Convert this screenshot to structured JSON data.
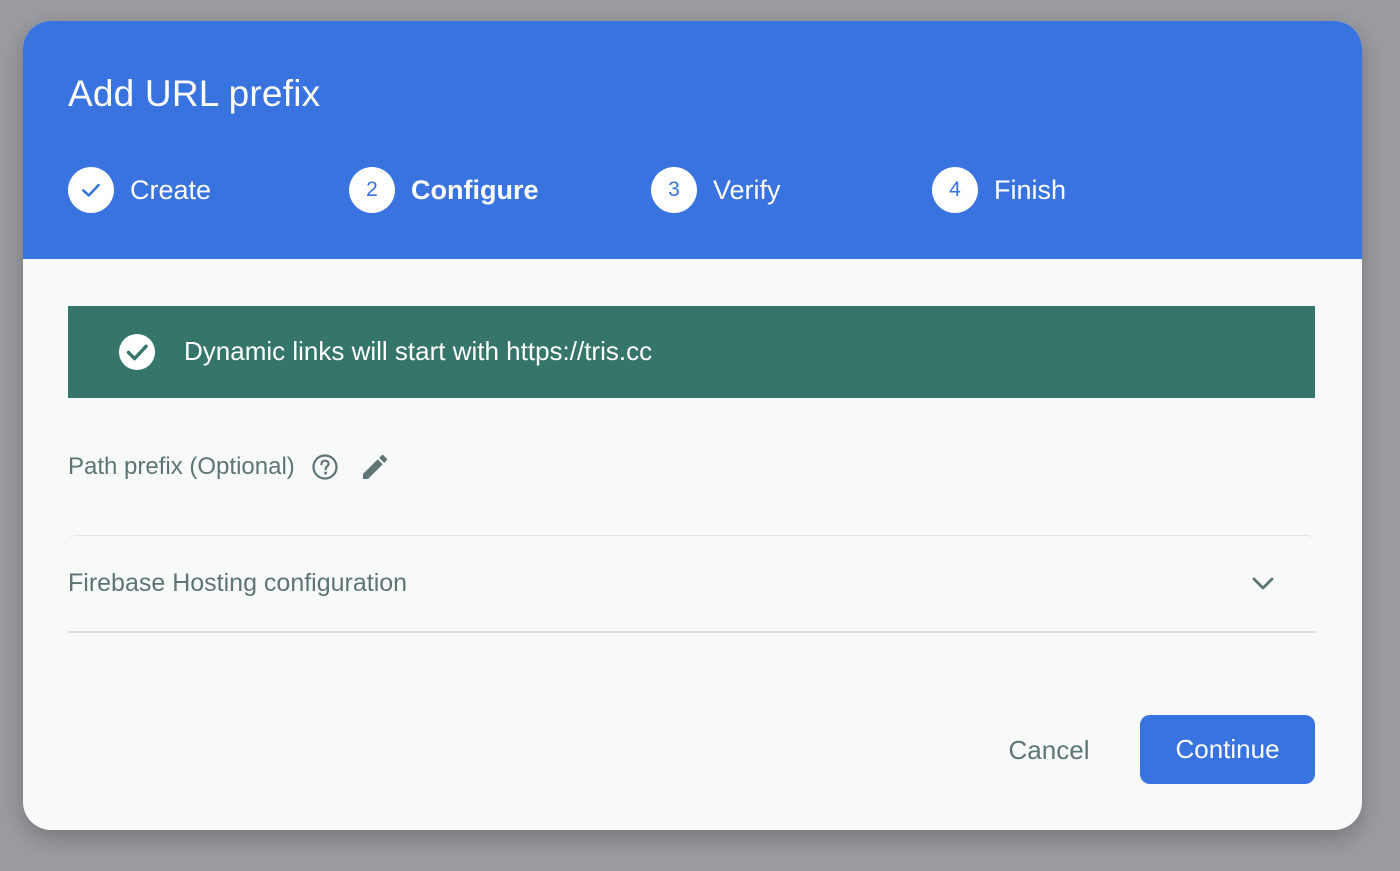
{
  "dialog": {
    "title": "Add URL prefix",
    "steps": [
      {
        "number": "",
        "label": "Create",
        "status": "complete",
        "icon": "check-icon"
      },
      {
        "number": "2",
        "label": "Configure",
        "status": "active"
      },
      {
        "number": "3",
        "label": "Verify",
        "status": "pending"
      },
      {
        "number": "4",
        "label": "Finish",
        "status": "pending"
      }
    ],
    "banner": {
      "icon": "check-circle-icon",
      "text": "Dynamic links will start with https://tris.cc"
    },
    "path_prefix": {
      "label": "Path prefix (Optional)",
      "help_icon": "help-circle-icon",
      "edit_icon": "pencil-icon"
    },
    "hosting_config": {
      "label": "Firebase Hosting configuration",
      "icon": "chevron-down-icon",
      "expanded": false
    },
    "actions": {
      "cancel_label": "Cancel",
      "continue_label": "Continue"
    }
  },
  "colors": {
    "header_blue": "#3873e0",
    "banner_green": "#36766a",
    "body_bg": "#f8f9f9",
    "muted_text": "#5e7575",
    "backdrop": "#9b9ca1"
  }
}
